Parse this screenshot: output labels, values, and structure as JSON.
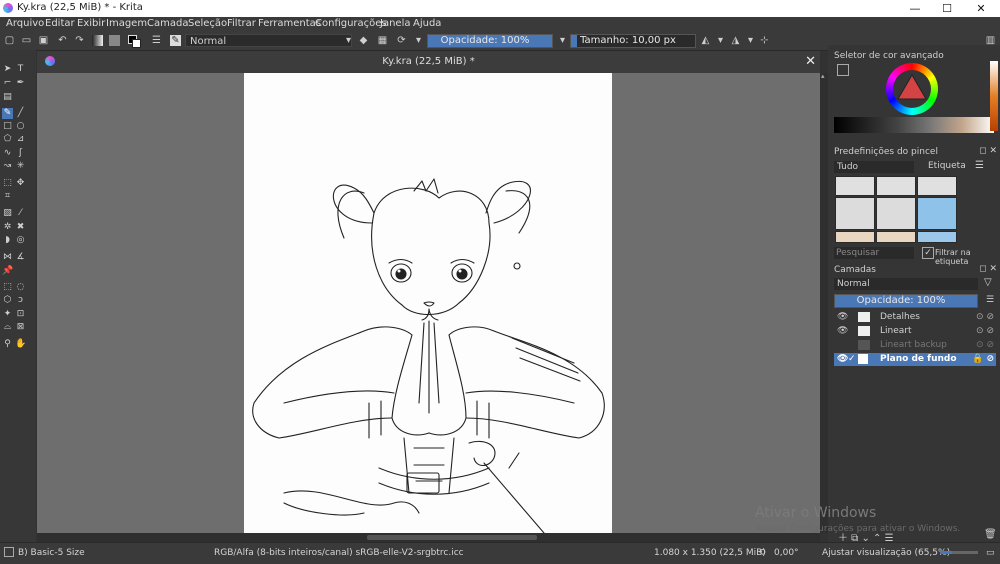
{
  "window": {
    "title": "Ky.kra (22,5 MiB) * - Krita",
    "controls": {
      "minimize": "—",
      "maximize": "☐",
      "close": "✕"
    }
  },
  "menu": [
    "Arquivo",
    "Editar",
    "Exibir",
    "Imagem",
    "Camada",
    "Seleção",
    "Filtrar",
    "Ferramentas",
    "Configurações",
    "Janela",
    "Ajuda"
  ],
  "toolbar": {
    "blend_mode": "Normal",
    "opacity_label": "Opacidade: 100%",
    "opacity_value": 1.0,
    "size_label": "Tamanho: 10,00 px",
    "size_value_fraction": 0.05
  },
  "document": {
    "tab_title": "Ky.kra (22,5 MiB) *",
    "close": "✕"
  },
  "color_selector": {
    "title": "Seletor de cor avançado"
  },
  "brush_presets": {
    "title": "Predefinições do pincel",
    "filter_all": "Tudo",
    "tag_label": "Etiqueta",
    "search_placeholder": "Pesquisar",
    "filter_tag_checkbox": "Filtrar na etiqueta"
  },
  "layers": {
    "title": "Camadas",
    "blend_mode": "Normal",
    "opacity_label": "Opacidade: 100%",
    "items": [
      {
        "name": "Detalhes",
        "visible": true,
        "selected": false
      },
      {
        "name": "Lineart",
        "visible": true,
        "selected": false
      },
      {
        "name": "Lineart backup",
        "visible": false,
        "selected": false
      },
      {
        "name": "Plano de fundo",
        "visible": true,
        "selected": true
      }
    ]
  },
  "watermark": {
    "line1": "Ativar o Windows",
    "line2": "Acesse Configurações para ativar o Windows."
  },
  "status": {
    "brush": "B) Basic-5 Size",
    "color_profile": "RGB/Alfa (8-bits inteiros/canal)  sRGB-elle-V2-srgbtrc.icc",
    "dimensions": "1.080 x 1.350 (22,5 MiB)",
    "rotation": "0,00°",
    "zoom": "Ajustar visualização (65,5%)"
  }
}
